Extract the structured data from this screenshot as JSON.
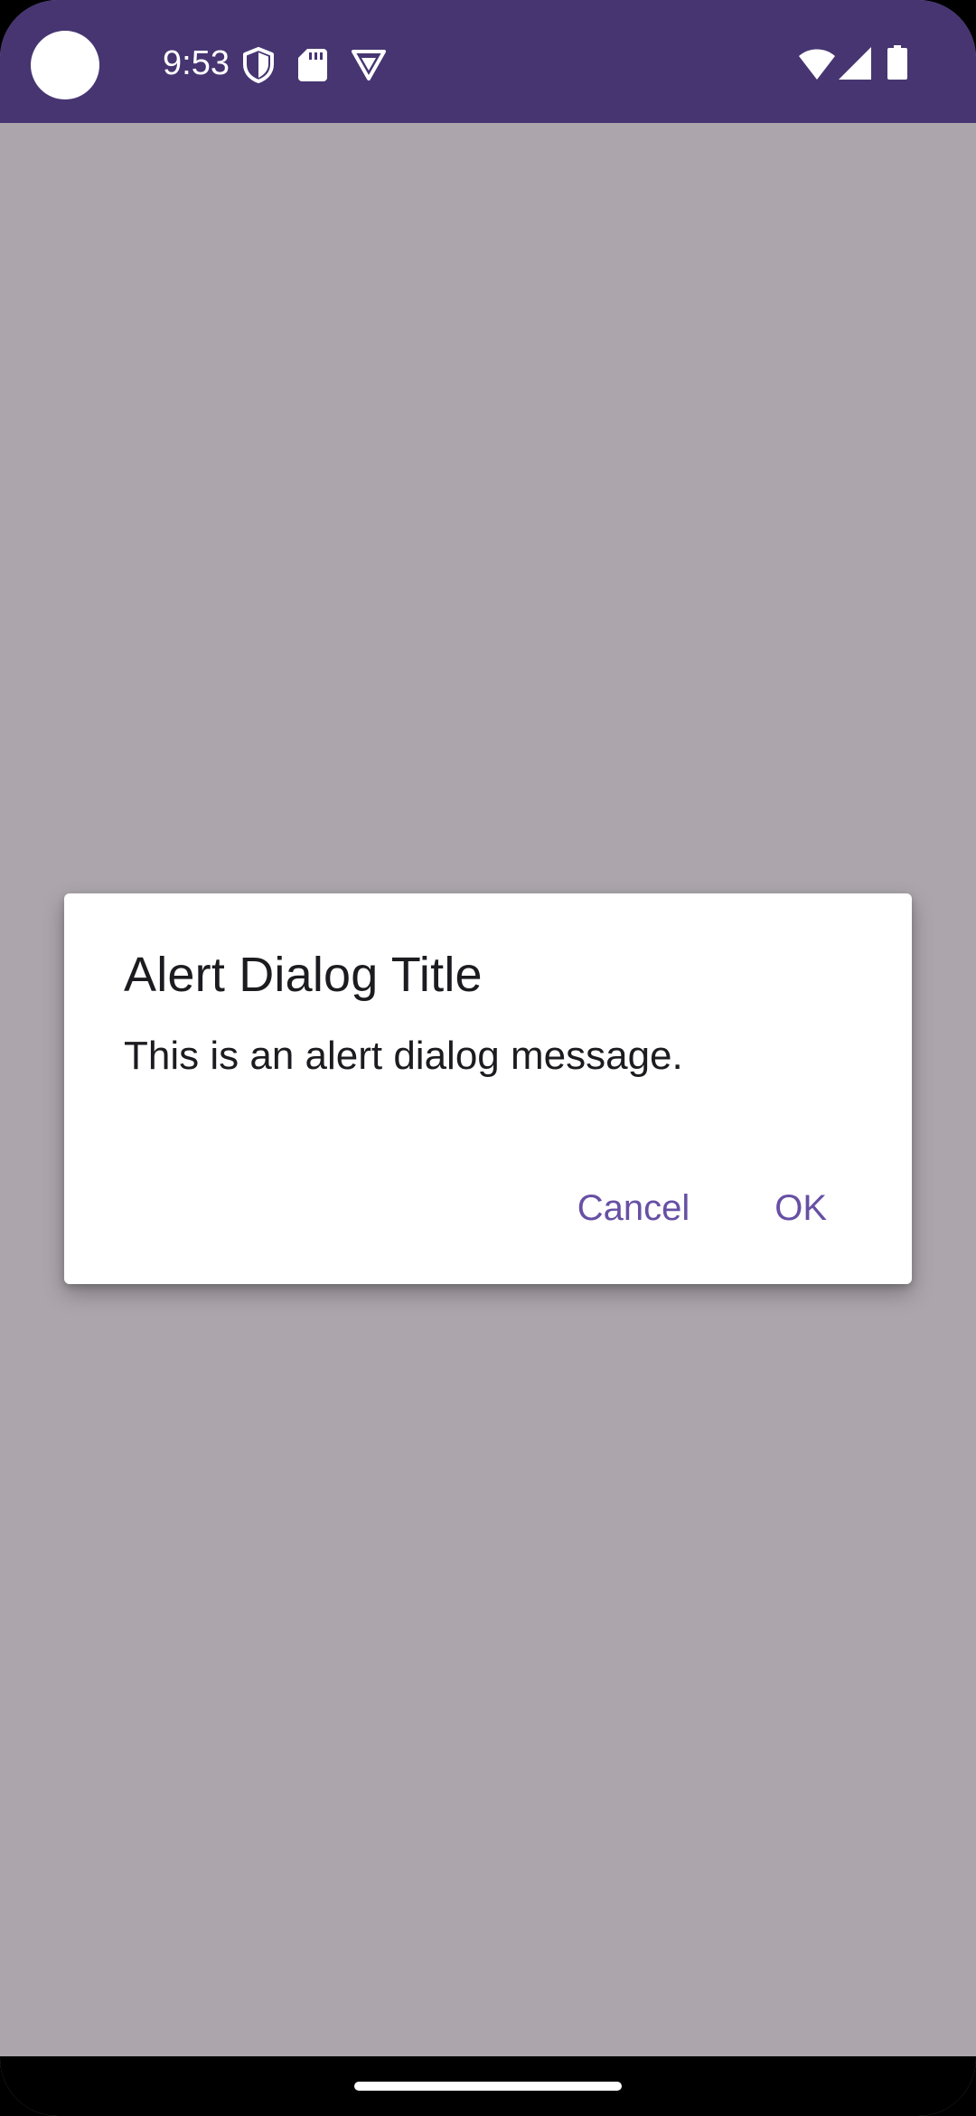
{
  "status_bar": {
    "time": "9:53",
    "background_color": "#463571",
    "left_icons": [
      "shield-icon",
      "sd-card-icon",
      "vpn-icon"
    ],
    "right_icons": [
      "wifi-icon",
      "cell-signal-icon",
      "battery-icon"
    ]
  },
  "screen": {
    "scrim_color": "#aca6ac"
  },
  "dialog": {
    "title": "Alert Dialog Title",
    "message": "This is an alert dialog message.",
    "buttons": {
      "cancel": "Cancel",
      "ok": "OK"
    },
    "button_color": "#6750a4"
  }
}
